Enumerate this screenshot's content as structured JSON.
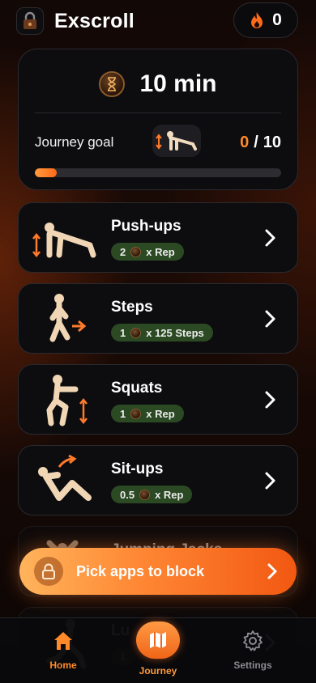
{
  "header": {
    "app_title": "Exscroll",
    "app_icon": "lock-icon",
    "streak_icon": "flame-icon",
    "streak_count": "0"
  },
  "goal_card": {
    "time_icon": "hourglass-coin-icon",
    "time": "10 min",
    "journey_label": "Journey goal",
    "journey_figure_icon": "pushup-figure-icon",
    "progress_current": "0",
    "progress_separator": "/",
    "progress_total": "10",
    "progress_fraction": 0.09
  },
  "exercises": [
    {
      "name": "Push-ups",
      "amount": "2",
      "unit": "x Rep",
      "icon": "pushup-figure-icon"
    },
    {
      "name": "Steps",
      "amount": "1",
      "unit": "x 125 Steps",
      "icon": "walking-figure-icon"
    },
    {
      "name": "Squats",
      "amount": "1",
      "unit": "x Rep",
      "icon": "squat-figure-icon"
    },
    {
      "name": "Sit-ups",
      "amount": "0.5",
      "unit": "x Rep",
      "icon": "situp-figure-icon"
    },
    {
      "name": "Jumping Jacks",
      "icon": "jumping-jack-figure-icon"
    },
    {
      "name": "Lu",
      "amount": "1",
      "icon": "lunge-figure-icon"
    }
  ],
  "cta": {
    "label": "Pick apps to block",
    "icon": "lock-icon"
  },
  "nav": {
    "home": "Home",
    "journey": "Journey",
    "settings": "Settings"
  },
  "colors": {
    "accent": "#ff8a2a",
    "badge_bg": "#2b4a23",
    "card_bg": "#0d0d10"
  }
}
